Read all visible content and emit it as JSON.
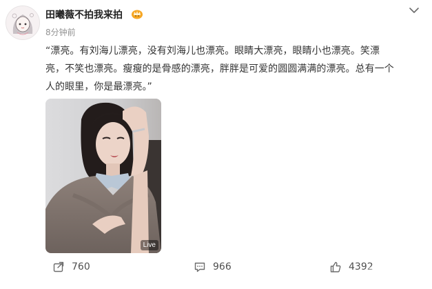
{
  "post": {
    "author": {
      "name": "田曦薇不拍我来拍",
      "avatar_icon": "avatar-icon",
      "badge_icon": "vip-crown-icon"
    },
    "time": "8分钟前",
    "menu_icon": "chevron-down-icon",
    "text_lines": [
      "“漂亮。有刘海儿漂亮，没有刘海儿也漂亮。眼睛大漂亮，眼睛小也漂亮。笑漂",
      "亮，不笑也漂亮。瘦瘦的是骨感的漂亮，胖胖是可爱的圆圆满满的漂亮。总有一个",
      "人的眼里，你是最漂亮。”"
    ],
    "image": {
      "badge": "Live"
    }
  },
  "actions": {
    "repost": {
      "icon": "share-icon",
      "count": "760"
    },
    "comment": {
      "icon": "comment-icon",
      "count": "966"
    },
    "like": {
      "icon": "thumbs-up-icon",
      "count": "4392"
    }
  },
  "colors": {
    "text": "#333333",
    "muted": "#939393",
    "icon": "#6b6b6b",
    "badge_orange": "#f6a623"
  }
}
